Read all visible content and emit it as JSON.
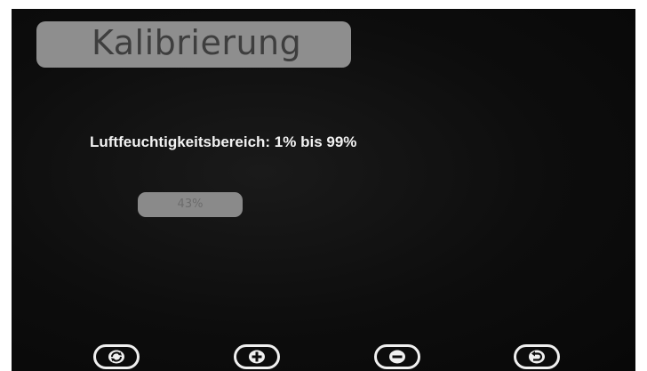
{
  "screen": {
    "title": "Kalibrierung",
    "range_label": "Luftfeuchtigkeitsbereich: 1% bis 99%",
    "current_value": "43%"
  },
  "softkeys": [
    {
      "icon": "refresh-icon"
    },
    {
      "icon": "plus-icon"
    },
    {
      "icon": "minus-icon"
    },
    {
      "icon": "back-icon"
    }
  ],
  "colors": {
    "screen_background": "#0d0d0d",
    "title_box": "#8e8e8e",
    "label_text": "#f2f2f2",
    "value_box": "#8a8a8a",
    "softkey_outline": "#f0f0f0"
  }
}
